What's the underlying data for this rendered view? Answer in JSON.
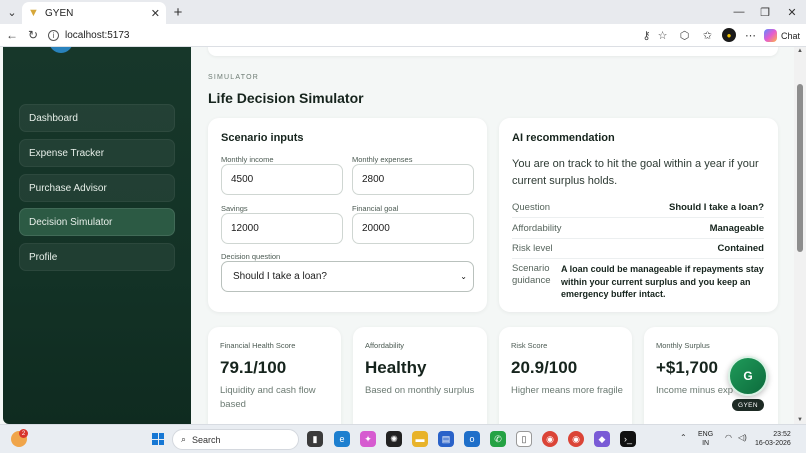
{
  "browser": {
    "tab_title": "GYEN",
    "url": "localhost:5173",
    "chat_label": "Chat"
  },
  "sidebar": {
    "items": [
      {
        "label": "Dashboard"
      },
      {
        "label": "Expense Tracker"
      },
      {
        "label": "Purchase Advisor"
      },
      {
        "label": "Decision Simulator",
        "active": true
      },
      {
        "label": "Profile"
      }
    ]
  },
  "page": {
    "eyebrow": "SIMULATOR",
    "title": "Life Decision Simulator"
  },
  "inputs": {
    "heading": "Scenario inputs",
    "monthly_income_label": "Monthly income",
    "monthly_income": "4500",
    "monthly_expenses_label": "Monthly expenses",
    "monthly_expenses": "2800",
    "savings_label": "Savings",
    "savings": "12000",
    "goal_label": "Financial goal",
    "goal": "20000",
    "question_label": "Decision question",
    "question": "Should I take a loan?"
  },
  "recommendation": {
    "heading": "AI recommendation",
    "text": "You are on track to hit the goal within a year if your current surplus holds.",
    "question_key": "Question",
    "question_value": "Should I take a loan?",
    "affordability_key": "Affordability",
    "affordability_value": "Manageable",
    "risk_key": "Risk level",
    "risk_value": "Contained",
    "guidance_key": "Scenario guidance",
    "guidance_value": "A loan could be manageable if repayments stay within your current surplus and you keep an emergency buffer intact."
  },
  "metrics": [
    {
      "label": "Financial Health Score",
      "value": "79.1/100",
      "sub": "Liquidity and cash flow based"
    },
    {
      "label": "Affordability",
      "value": "Healthy",
      "sub": "Based on monthly surplus"
    },
    {
      "label": "Risk Score",
      "value": "20.9/100",
      "sub": "Higher means more fragile"
    },
    {
      "label": "Monthly Surplus",
      "value": "+$1,700",
      "sub": "Income minus exp"
    }
  ],
  "assistant": {
    "initial": "G",
    "badge": "GYEN"
  },
  "taskbar": {
    "search_placeholder": "Search",
    "notification_count": "2",
    "lang_line1": "ENG",
    "lang_line2": "IN",
    "time": "23:52",
    "date": "16-03-2026"
  },
  "colors": {
    "sidebar_bg": "#17372a",
    "active_nav": "#2c5a44",
    "accent_green": "#1f9b5a"
  }
}
